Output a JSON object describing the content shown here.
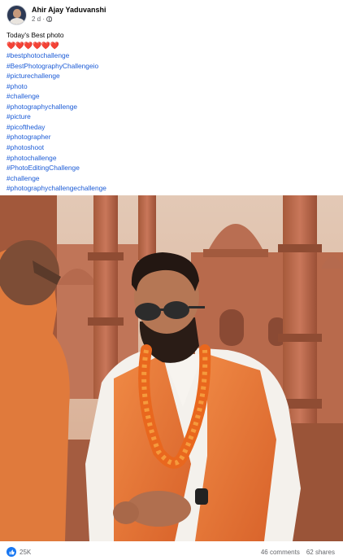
{
  "post": {
    "author": "Ahir Ajay Yaduvanshi",
    "time": "2 d ·",
    "caption": "Today's Best photo",
    "hearts": "❤️❤️❤️❤️❤️❤️",
    "hashtags": [
      "#bestphotochallenge",
      "#BestPhotographyChallengeio",
      "#picturechallenge",
      "#photo",
      "#challenge",
      "#photographychallenge",
      "#picture",
      "#picoftheday",
      "#photographer",
      "#photoshoot",
      "#photochallenge",
      "#PhotoEditingChallenge",
      "#challenge",
      "#photographychallengechallenge"
    ]
  },
  "footer": {
    "reactions": "25K",
    "comments": "46 comments",
    "shares": "62 shares"
  },
  "colors": {
    "link": "#1b5bd6",
    "like": "#1877f2",
    "muted": "#65676b"
  }
}
